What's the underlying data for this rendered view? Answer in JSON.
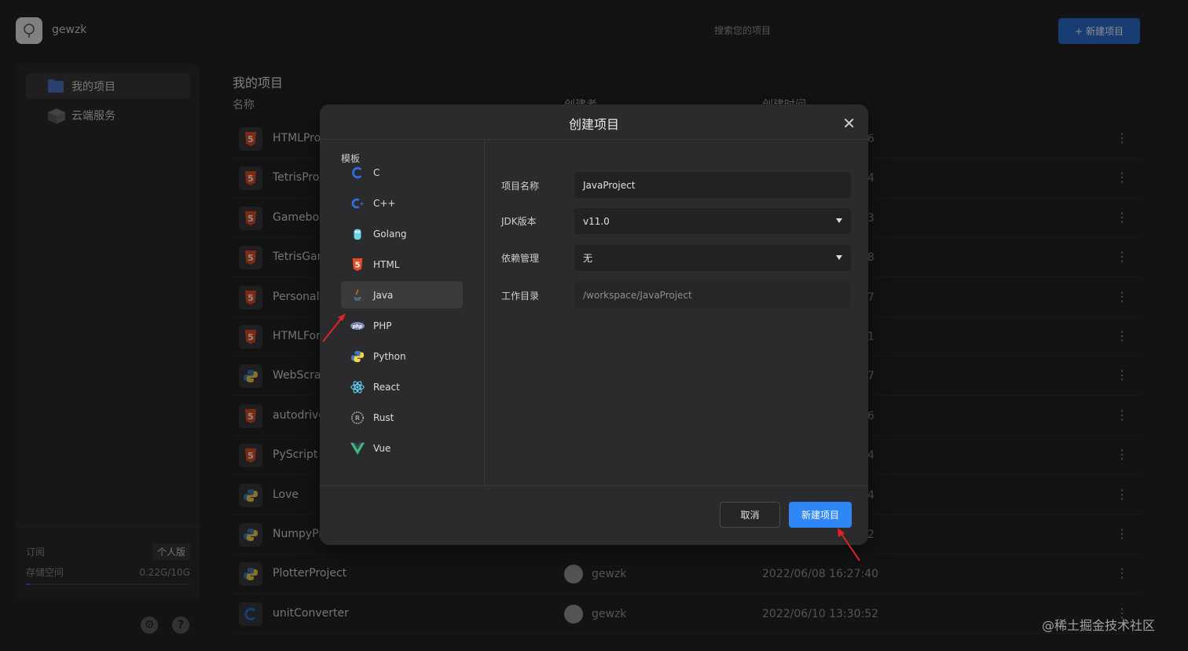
{
  "header": {
    "username": "gewzk",
    "search_placeholder": "搜索您的项目",
    "new_project_button": "新建项目",
    "plus": "+"
  },
  "sidebar": {
    "items": [
      {
        "label": "我的项目",
        "icon": "folder-icon",
        "active": true
      },
      {
        "label": "云端服务",
        "icon": "cube-icon",
        "active": false
      }
    ],
    "subscription_label": "订阅",
    "subscription_badge": "个人版",
    "storage_label": "存储空间",
    "storage_value": "0.22G/10G",
    "storage_fraction": 0.022
  },
  "main": {
    "title": "我的项目",
    "columns": {
      "name": "名称",
      "creator": "创建者",
      "created_at": "创建时间"
    },
    "rows": [
      {
        "name": "HTMLPro",
        "icon": "html5-icon",
        "creator": "",
        "time": "6"
      },
      {
        "name": "TetrisPro",
        "icon": "html5-icon",
        "creator": "",
        "time": "4"
      },
      {
        "name": "Gameboy",
        "icon": "html5-icon",
        "creator": "",
        "time": "3"
      },
      {
        "name": "TetrisGar",
        "icon": "html5-icon",
        "creator": "",
        "time": "8"
      },
      {
        "name": "Personal",
        "icon": "html5-icon",
        "creator": "",
        "time": "7"
      },
      {
        "name": "HTMLFor",
        "icon": "html5-icon",
        "creator": "",
        "time": "1"
      },
      {
        "name": "WebScra",
        "icon": "python-icon",
        "creator": "",
        "time": "7"
      },
      {
        "name": "autodrive",
        "icon": "html5-icon",
        "creator": "",
        "time": "6"
      },
      {
        "name": "PyScript",
        "icon": "html5-icon",
        "creator": "",
        "time": "4"
      },
      {
        "name": "Love",
        "icon": "python-icon",
        "creator": "",
        "time": "4"
      },
      {
        "name": "NumpyPr",
        "icon": "python-icon",
        "creator": "",
        "time": "2"
      },
      {
        "name": "PlotterProject",
        "icon": "python-icon",
        "creator": "gewzk",
        "time": "2022/06/08 16:27:40"
      },
      {
        "name": "unitConverter",
        "icon": "c-icon",
        "creator": "gewzk",
        "time": "2022/06/10 13:30:52"
      }
    ],
    "more": "⋮"
  },
  "modal": {
    "title": "创建项目",
    "close": "✕",
    "templates_label": "模板",
    "templates": [
      {
        "label": "C",
        "icon": "c-icon"
      },
      {
        "label": "C++",
        "icon": "cpp-icon"
      },
      {
        "label": "Golang",
        "icon": "golang-icon"
      },
      {
        "label": "HTML",
        "icon": "html5-icon"
      },
      {
        "label": "Java",
        "icon": "java-icon",
        "active": true
      },
      {
        "label": "PHP",
        "icon": "php-icon"
      },
      {
        "label": "Python",
        "icon": "python-icon"
      },
      {
        "label": "React",
        "icon": "react-icon"
      },
      {
        "label": "Rust",
        "icon": "rust-icon"
      },
      {
        "label": "Vue",
        "icon": "vue-icon"
      }
    ],
    "form": {
      "name_label": "项目名称",
      "name_value": "JavaProject",
      "jdk_label": "JDK版本",
      "jdk_value": "v11.0",
      "deps_label": "依赖管理",
      "deps_value": "无",
      "workdir_label": "工作目录",
      "workdir_value": "/workspace/JavaProject"
    },
    "cancel_button": "取消",
    "create_button": "新建项目"
  },
  "watermark": "@稀土掘金技术社区",
  "colors": {
    "accent": "#2f86f5",
    "background": "#232325",
    "html5": "#e44d26",
    "arrow": "#e02424"
  }
}
